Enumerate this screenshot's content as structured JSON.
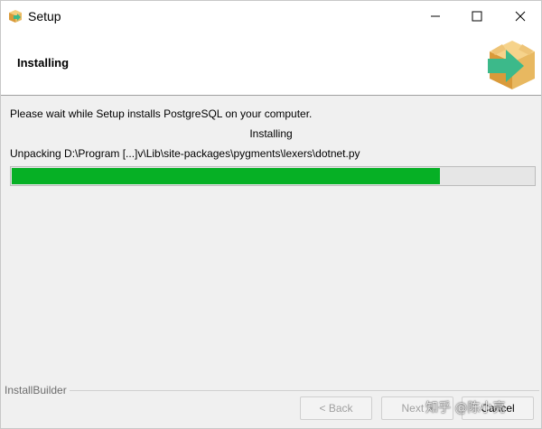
{
  "window": {
    "title": "Setup"
  },
  "header": {
    "title": "Installing"
  },
  "content": {
    "message": "Please wait while Setup installs PostgreSQL on your computer.",
    "status": "Installing",
    "unpacking": "Unpacking D:\\Program [...]v\\Lib\\site-packages\\pygments\\lexers\\dotnet.py",
    "progress_fraction": 0.82
  },
  "footer": {
    "brand": "InstallBuilder",
    "back_label": "< Back",
    "next_label": "Next >",
    "cancel_label": "Cancel",
    "watermark": "知乎 @陈小亮"
  },
  "colors": {
    "progress": "#06b025",
    "box": "#e8b860",
    "arrow": "#3cb98a"
  }
}
